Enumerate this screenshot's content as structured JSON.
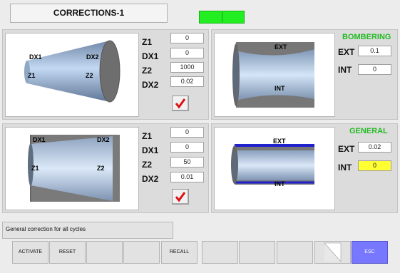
{
  "header": {
    "title": "CORRECTIONS-1"
  },
  "panel_conical_outer": {
    "diagram_labels": {
      "dx1": "DX1",
      "dx2": "DX2",
      "z1": "Z1",
      "z2": "Z2"
    },
    "fields": [
      {
        "label": "Z1",
        "value": "0"
      },
      {
        "label": "DX1",
        "value": "0"
      },
      {
        "label": "Z2",
        "value": "1000"
      },
      {
        "label": "DX2",
        "value": "0.02"
      }
    ]
  },
  "panel_conical_inner": {
    "diagram_labels": {
      "dx1": "DX1",
      "dx2": "DX2",
      "z1": "Z1",
      "z2": "Z2"
    },
    "fields": [
      {
        "label": "Z1",
        "value": "0"
      },
      {
        "label": "DX1",
        "value": "0"
      },
      {
        "label": "Z2",
        "value": "50"
      },
      {
        "label": "DX2",
        "value": "0.01"
      }
    ]
  },
  "panel_bombering": {
    "title": "BOMBERING",
    "diagram_labels": {
      "ext": "EXT",
      "int": "INT"
    },
    "fields": [
      {
        "label": "EXT",
        "value": "0.1"
      },
      {
        "label": "INT",
        "value": "0"
      }
    ]
  },
  "panel_general": {
    "title": "GENERAL",
    "diagram_labels": {
      "ext": "EXT",
      "int": "INT"
    },
    "fields": [
      {
        "label": "EXT",
        "value": "0.02"
      },
      {
        "label": "INT",
        "value": "0"
      }
    ]
  },
  "message": "General correction for all cycles",
  "toolbar": {
    "buttons": [
      "ACTIVATE",
      "RESET",
      "",
      "",
      "RECALL",
      "",
      "",
      "",
      "",
      "ESC"
    ]
  },
  "colors": {
    "status_green": "#22ee22",
    "section_green": "#22bb22",
    "esc_blue": "#7777ff",
    "highlight_yellow": "#ffff33"
  },
  "icons": {
    "check": "checkmark-icon",
    "page_curl": "page-curl-icon"
  }
}
